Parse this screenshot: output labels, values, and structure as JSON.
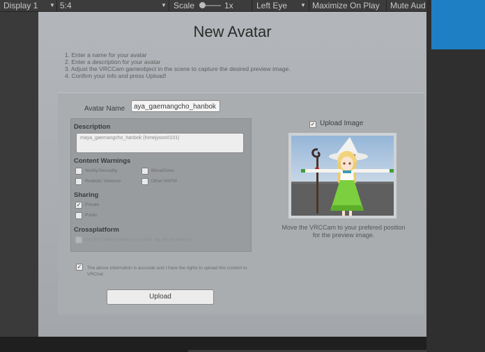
{
  "toolbar": {
    "display": "Display 1",
    "aspect": "5:4",
    "scale_label": "Scale",
    "scale_value": "1x",
    "eye": "Left Eye",
    "maximize": "Maximize On Play",
    "mute": "Mute Aud"
  },
  "panel": {
    "title": "New Avatar",
    "steps": [
      "1. Enter a name for your avatar",
      "2. Enter a description for your avatar",
      "3. Adjust the VRCCam gameobject in the scene to capture the desired preview image.",
      "4. Confirm your info and press Upload!"
    ],
    "name_label": "Avatar Name",
    "name_value": "aya_gaemangcho_hanbok",
    "description_label": "Description",
    "description_value": "maya_gaemangcho_hanbok (himejyoon0101)",
    "content_warnings_label": "Content Warnings",
    "warnings": {
      "nudity": "Nudity/Sexuality",
      "blood": "Blood/Gore",
      "violence": "Realistic Violence",
      "nsfw": "Other NSFW"
    },
    "sharing_label": "Sharing",
    "sharing": {
      "private": "Private",
      "public": "Public",
      "private_checked": true
    },
    "crossplatform_label": "Crossplatform",
    "fallback": "Use for Fallback (avatar not valid, tag will be cleared)",
    "agree_text": "The above information is accurate and I have the rights to upload this content to VRChat.",
    "agree_checked": true,
    "upload_button": "Upload",
    "upload_image_label": "Upload Image",
    "upload_image_checked": true,
    "preview_note": "Move the VRCCam to your prefered position for the preview image."
  },
  "colors": {
    "unity_blue": "#1e7fc4",
    "toolbar": "#3c3c3c"
  }
}
